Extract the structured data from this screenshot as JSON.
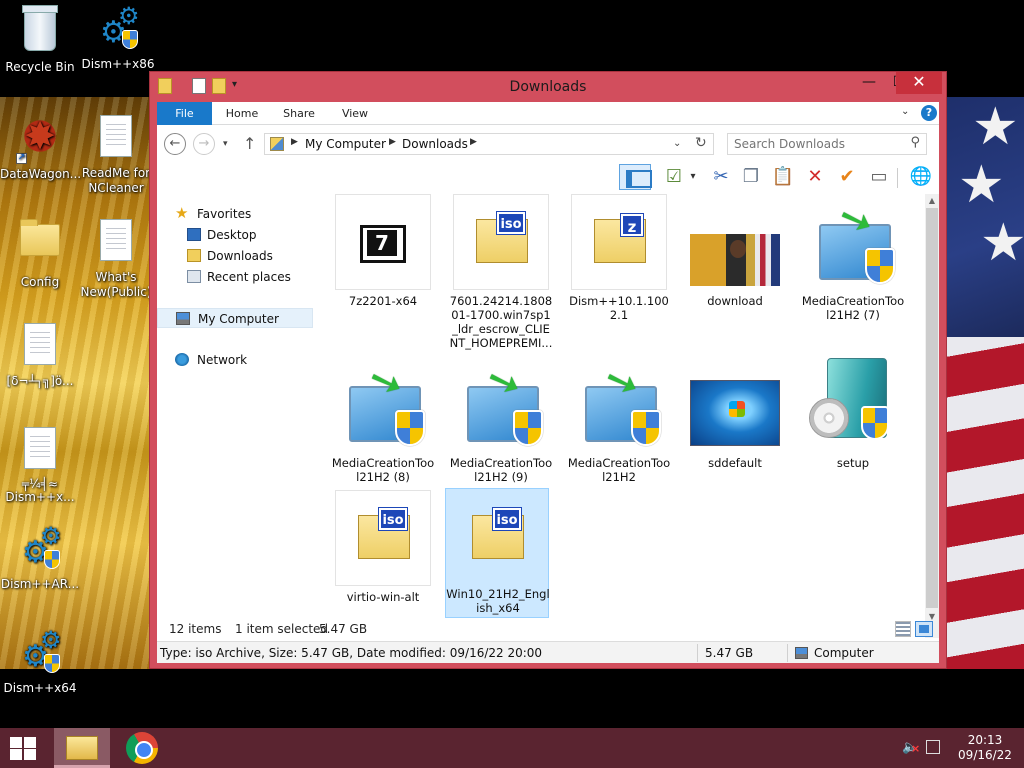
{
  "desktop": {
    "icons": [
      {
        "label": "Recycle Bin"
      },
      {
        "label": "Dism++x86"
      },
      {
        "label": "DataWagon..."
      },
      {
        "label": "ReadMe for NCleaner"
      },
      {
        "label": "Config"
      },
      {
        "label": "What's New(Public)"
      },
      {
        "label": "[δ¬┴┐╗]ö..."
      },
      {
        "label": "╤¼╡≈\nDism++x..."
      },
      {
        "label": "Dism++AR..."
      },
      {
        "label": "Dism++x64"
      }
    ]
  },
  "window": {
    "title": "Downloads",
    "controls": {
      "minimize": "—",
      "maximize": "☐",
      "close": "✕"
    },
    "ribbon": {
      "tabs": [
        "File",
        "Home",
        "Share",
        "View"
      ]
    },
    "address": {
      "crumbs": [
        "My Computer",
        "Downloads"
      ]
    },
    "search": {
      "placeholder": "Search Downloads"
    },
    "nav_pane": {
      "favorites_label": "Favorites",
      "favorites": [
        "Desktop",
        "Downloads",
        "Recent places"
      ],
      "computer": "My Computer",
      "network": "Network"
    },
    "files": [
      {
        "name": "7z2201-x64",
        "icon": "7zip-icon"
      },
      {
        "name": "7601.24214.180801-1700.win7sp1_ldr_escrow_CLIENT_HOMEPREMI...",
        "icon": "iso-icon"
      },
      {
        "name": "Dism++10.1.1002.1",
        "icon": "zip-icon"
      },
      {
        "name": "download",
        "icon": "photo-icon"
      },
      {
        "name": "MediaCreationTool21H2 (7)",
        "icon": "installer-icon"
      },
      {
        "name": "MediaCreationTool21H2 (8)",
        "icon": "installer-icon"
      },
      {
        "name": "MediaCreationTool21H2 (9)",
        "icon": "installer-icon"
      },
      {
        "name": "MediaCreationTool21H2",
        "icon": "installer-icon"
      },
      {
        "name": "sddefault",
        "icon": "photo-icon"
      },
      {
        "name": "setup",
        "icon": "setup-icon"
      },
      {
        "name": "virtio-win-alt",
        "icon": "iso-icon"
      },
      {
        "name": "Win10_21H2_English_x64",
        "icon": "iso-icon",
        "selected": true
      }
    ],
    "status": {
      "items": "12 items",
      "selected": "1 item selected",
      "size": "5.47 GB"
    },
    "details": {
      "text": "Type: iso Archive, Size: 5.47 GB, Date modified: 09/16/22 20:00",
      "size": "5.47 GB",
      "location": "Computer"
    }
  },
  "taskbar": {
    "time": "20:13",
    "date": "09/16/22"
  },
  "colors": {
    "window_frame": "#d24e5d",
    "taskbar": "#5a2430",
    "file_tab": "#1979ca",
    "selection": "#cce8ff"
  }
}
